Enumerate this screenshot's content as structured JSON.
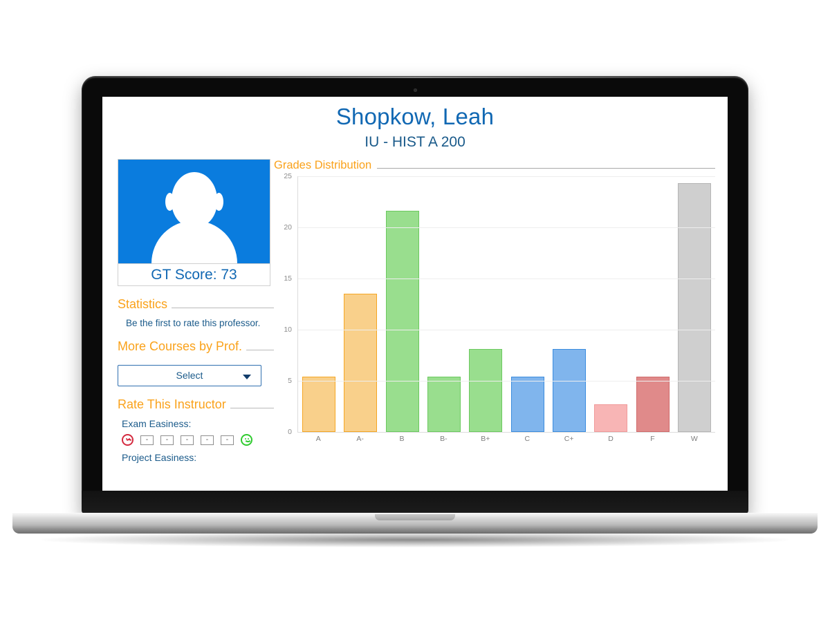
{
  "header": {
    "professor_name": "Shopkow, Leah",
    "course": "IU - HIST A 200"
  },
  "sidebar": {
    "avatar": {
      "icon": "person-silhouette-icon",
      "gt_score_label": "GT Score: 73"
    },
    "statistics": {
      "heading": "Statistics",
      "text": "Be the first to rate this professor."
    },
    "more_courses": {
      "heading": "More Courses by Prof.",
      "select_value": "Select",
      "caret_icon": "chevron-down-icon"
    },
    "rate": {
      "heading": "Rate This Instructor",
      "items": [
        {
          "label": "Exam Easiness:"
        },
        {
          "label": "Project Easiness:"
        }
      ],
      "sad_icon": "frowning-face-icon",
      "happy_icon": "smiling-face-icon",
      "tick_marks": [
        "-",
        "-",
        "-",
        "-",
        "-"
      ]
    }
  },
  "chart_panel": {
    "heading": "Grades Distribution"
  },
  "colors": {
    "accent_orange": "#faa21b",
    "title_blue": "#1168b3",
    "text_blue": "#1a5a8a",
    "avatar_bg": "#0a7cde",
    "bar_orange_fill": "#f9d08b",
    "bar_orange_stroke": "#f5a623",
    "bar_green_fill": "#99de8e",
    "bar_green_stroke": "#6bc95f",
    "bar_blue_fill": "#80b5ed",
    "bar_blue_stroke": "#3b8cde",
    "bar_pink_fill": "#f8b5b5",
    "bar_pink_stroke": "#f09a9a",
    "bar_rose_fill": "#e08a8a",
    "bar_rose_stroke": "#d06a6a",
    "bar_gray_fill": "#cfcfcf",
    "bar_gray_stroke": "#b5b5b5"
  },
  "chart_data": {
    "type": "bar",
    "title": "Grades Distribution",
    "xlabel": "",
    "ylabel": "",
    "categories": [
      "A",
      "A-",
      "B",
      "B-",
      "B+",
      "C",
      "C+",
      "D",
      "F",
      "W"
    ],
    "values": [
      5.4,
      13.5,
      21.6,
      5.4,
      8.1,
      5.4,
      8.1,
      2.7,
      5.4,
      24.3
    ],
    "bar_colors": [
      "#f9d08b",
      "#f9d08b",
      "#99de8e",
      "#99de8e",
      "#99de8e",
      "#80b5ed",
      "#80b5ed",
      "#f8b5b5",
      "#e08a8a",
      "#cfcfcf"
    ],
    "bar_strokes": [
      "#f5a623",
      "#f5a623",
      "#6bc95f",
      "#6bc95f",
      "#6bc95f",
      "#3b8cde",
      "#3b8cde",
      "#f09a9a",
      "#d06a6a",
      "#b5b5b5"
    ],
    "ylim": [
      0,
      25
    ],
    "yticks": [
      0,
      5,
      10,
      15,
      20,
      25
    ],
    "grid": true,
    "legend": false
  }
}
